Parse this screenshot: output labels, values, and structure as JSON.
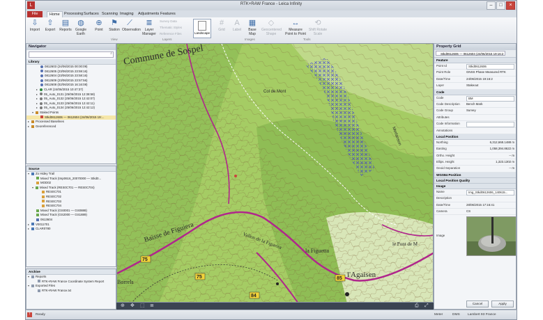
{
  "window": {
    "title": "RTK+RAW France - Leica Infinity"
  },
  "tabs": [
    {
      "label": "File"
    },
    {
      "label": "Home"
    },
    {
      "label": "Processing"
    },
    {
      "label": "Surfaces"
    },
    {
      "label": "Scanning"
    },
    {
      "label": "Imaging"
    },
    {
      "label": "Adjustments"
    },
    {
      "label": "Features"
    }
  ],
  "ribbon": {
    "buttons": [
      {
        "label": "Import"
      },
      {
        "label": "Export"
      },
      {
        "label": "Reports"
      },
      {
        "label": "Google Earth"
      },
      {
        "label": "Point"
      },
      {
        "label": "Station"
      },
      {
        "label": "Observation"
      },
      {
        "label": "Layer Manager"
      },
      {
        "label": "Landscape"
      },
      {
        "label": "Grid"
      },
      {
        "label": "Label"
      },
      {
        "label": "Base Map"
      },
      {
        "label": "Geocentered Shape"
      },
      {
        "label": "Measure Point to Point"
      },
      {
        "label": "Shift Rotate Scale"
      }
    ],
    "small_items": [
      "Survey Data",
      "Thematic Styles",
      "Reference Files"
    ],
    "groups": [
      "View",
      "Layers",
      "Images",
      "Tools"
    ]
  },
  "navigator": {
    "title": "Navigator",
    "library_header": "Library",
    "library_items": [
      "0812603 (24/06/2015 00:00:09)",
      "0812605 (23/06/2015 23:59:16)",
      "0812604 (23/06/2015 23:58:16)",
      "0812609 (23/06/2015 23:57:56)",
      "0812608 (02/06/2015 16:16:08)",
      "CLAR (24/06/2015 10:47:37)",
      "05_Auto_0131 (25/06/2015 12:38:58)",
      "05_Auto_0132 (25/06/2015 12:42:07)",
      "05_Auto_0133 (25/06/2015 12:42:11)",
      "05_Auto_0134 (25/06/2015 12:42:12)",
      "Staked Points",
      "Stkd0612606 — 0612604 (24/06/2015 19:...",
      "Processed Baselines",
      "Georeferenced"
    ],
    "source_header": "Source",
    "source_items": [
      "Zo Hidey Trail",
      "Mixed Track (tmp0616_20070000 — Stkd0...",
      "MOD02",
      "Mixed Track (RES0C701 — RES0C704)",
      "RES0C701",
      "RES0C702",
      "RES0C703",
      "RES0C704",
      "Mixed Track (GS0001 — GS0888)",
      "Mixed Track (GS2000 — GS1889)",
      "0613604",
      "V0011701",
      "CLAR0780"
    ],
    "archive_header": "Archive",
    "archive_items": [
      "Reports",
      "RTK+RAW France Coordinate System Report",
      "Exported Files",
      "RTK+RAW France.txt"
    ]
  },
  "map": {
    "labels": [
      "Commune de Sospel",
      "Col de Mont",
      "Baisse de Figuiera",
      "Vallon de la Figueira",
      "la Figuetta",
      "l'Agaisen",
      "le Pont de M",
      "Borrels",
      "Merlanson"
    ],
    "road_numbers": [
      "75",
      "75",
      "84",
      "85"
    ]
  },
  "property_grid": {
    "title": "Property Grid",
    "selector": "Stkd0612606 — 0612604 (24/06/2015 19:16:2",
    "groups": {
      "feature": "Feature",
      "code": "Code",
      "local_position": "Local Position",
      "wgs84": "WGS84 Position",
      "quality": "Local Position Quality",
      "image": "Image"
    },
    "feature_rows": [
      {
        "key": "Point Id",
        "value": "Stkd0612606"
      },
      {
        "key": "Point Role",
        "value": "GNSS Phase Measured RTK"
      },
      {
        "key": "Date/Time",
        "value": "24/06/2015 19:16:2"
      },
      {
        "key": "Layer",
        "value": "Stakeout"
      }
    ],
    "code_rows": [
      {
        "key": "Code",
        "value": "BM"
      },
      {
        "key": "Code Description",
        "value": "Bench Mark"
      },
      {
        "key": "Code Group",
        "value": "Survey"
      },
      {
        "key": "Attributes",
        "value": ""
      },
      {
        "key": "Code Information",
        "value": ""
      },
      {
        "key": "Annotations",
        "value": ""
      }
    ],
    "position_rows": [
      {
        "key": "Northing",
        "value": "6,312,668.1488 m"
      },
      {
        "key": "Easting",
        "value": "1,058,394.8622 m"
      },
      {
        "key": "Ortho. Height",
        "value": "-- m"
      },
      {
        "key": "Ellips. Height",
        "value": "1,323.1302 m"
      },
      {
        "key": "Geoid Separation",
        "value": "-- m"
      }
    ],
    "image_rows": [
      {
        "key": "Name",
        "value": "Img_Stkd0612606_140615..."
      },
      {
        "key": "Description",
        "value": ""
      },
      {
        "key": "Date/Time",
        "value": "28/06/2015 17:16:41"
      },
      {
        "key": "Camera",
        "value": "CS"
      },
      {
        "key": "Image",
        "value": ""
      }
    ],
    "cancel_label": "Cancel",
    "apply_label": "Apply"
  },
  "status": {
    "left": "Ready",
    "units": "Meter",
    "angle": "DMS",
    "crs": "Lambert 93 France"
  },
  "colors": {
    "accent": "#b8312f",
    "panel_header": "#c8d0da",
    "map_green": "#9bc45a"
  }
}
